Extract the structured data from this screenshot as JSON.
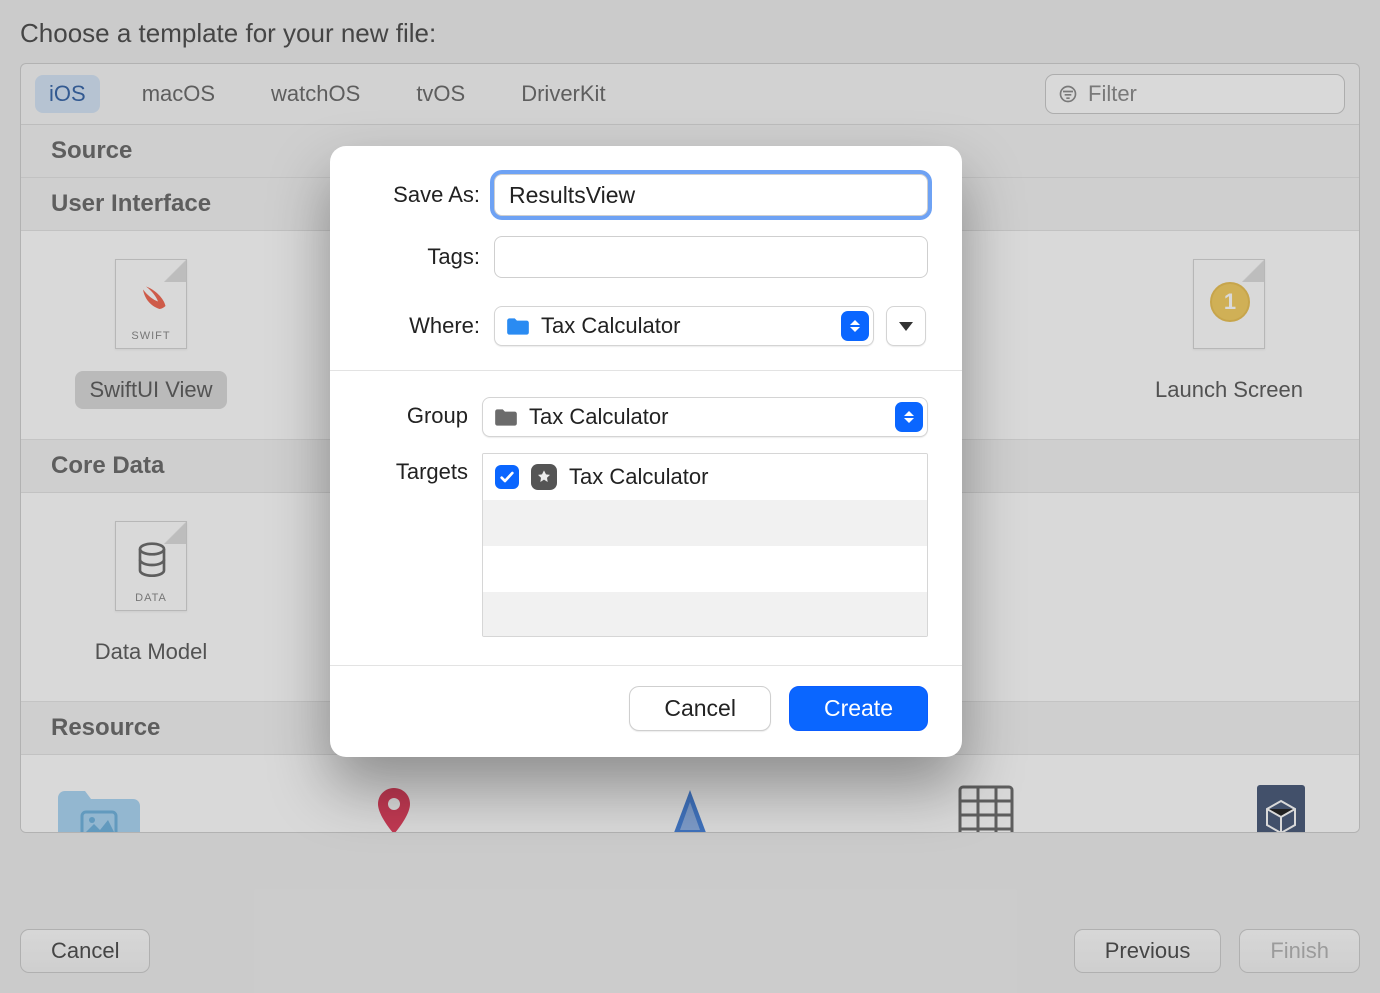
{
  "bg": {
    "title": "Choose a template for your new file:",
    "tabs": [
      "iOS",
      "macOS",
      "watchOS",
      "tvOS",
      "DriverKit"
    ],
    "selected_tab": "iOS",
    "filter_placeholder": "Filter",
    "sections": {
      "source_header": "Source",
      "ui_header": "User Interface",
      "core_data_header": "Core Data",
      "resource_header": "Resource"
    },
    "ui_items": {
      "swiftui": {
        "label": "SwiftUI View",
        "caption": "SWIFT"
      },
      "launch": {
        "label": "Launch Screen",
        "badge": "1"
      }
    },
    "core_data_items": {
      "model": {
        "label": "Data Model",
        "caption": "DATA"
      }
    },
    "buttons": {
      "cancel": "Cancel",
      "previous": "Previous",
      "finish": "Finish"
    }
  },
  "sheet": {
    "labels": {
      "save_as": "Save As:",
      "tags": "Tags:",
      "where": "Where:",
      "group": "Group",
      "targets": "Targets"
    },
    "save_as_value": "ResultsView",
    "tags_value": "",
    "where_value": "Tax Calculator",
    "group_value": "Tax Calculator",
    "targets": [
      {
        "checked": true,
        "name": "Tax Calculator"
      }
    ],
    "buttons": {
      "cancel": "Cancel",
      "create": "Create"
    }
  }
}
